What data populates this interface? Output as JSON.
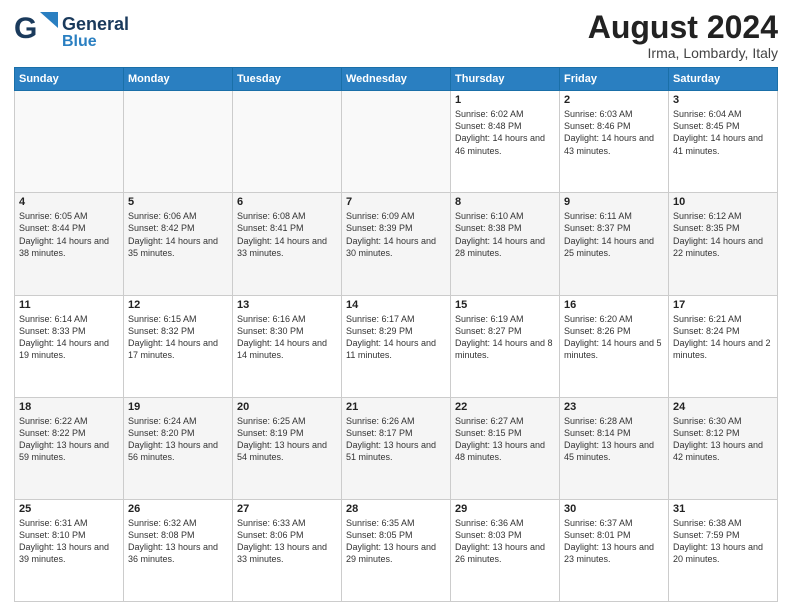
{
  "header": {
    "logo_line1": "General",
    "logo_line2": "Blue",
    "main_title": "August 2024",
    "sub_title": "Irma, Lombardy, Italy"
  },
  "weekdays": [
    "Sunday",
    "Monday",
    "Tuesday",
    "Wednesday",
    "Thursday",
    "Friday",
    "Saturday"
  ],
  "weeks": [
    [
      {
        "num": "",
        "info": ""
      },
      {
        "num": "",
        "info": ""
      },
      {
        "num": "",
        "info": ""
      },
      {
        "num": "",
        "info": ""
      },
      {
        "num": "1",
        "info": "Sunrise: 6:02 AM\nSunset: 8:48 PM\nDaylight: 14 hours and 46 minutes."
      },
      {
        "num": "2",
        "info": "Sunrise: 6:03 AM\nSunset: 8:46 PM\nDaylight: 14 hours and 43 minutes."
      },
      {
        "num": "3",
        "info": "Sunrise: 6:04 AM\nSunset: 8:45 PM\nDaylight: 14 hours and 41 minutes."
      }
    ],
    [
      {
        "num": "4",
        "info": "Sunrise: 6:05 AM\nSunset: 8:44 PM\nDaylight: 14 hours and 38 minutes."
      },
      {
        "num": "5",
        "info": "Sunrise: 6:06 AM\nSunset: 8:42 PM\nDaylight: 14 hours and 35 minutes."
      },
      {
        "num": "6",
        "info": "Sunrise: 6:08 AM\nSunset: 8:41 PM\nDaylight: 14 hours and 33 minutes."
      },
      {
        "num": "7",
        "info": "Sunrise: 6:09 AM\nSunset: 8:39 PM\nDaylight: 14 hours and 30 minutes."
      },
      {
        "num": "8",
        "info": "Sunrise: 6:10 AM\nSunset: 8:38 PM\nDaylight: 14 hours and 28 minutes."
      },
      {
        "num": "9",
        "info": "Sunrise: 6:11 AM\nSunset: 8:37 PM\nDaylight: 14 hours and 25 minutes."
      },
      {
        "num": "10",
        "info": "Sunrise: 6:12 AM\nSunset: 8:35 PM\nDaylight: 14 hours and 22 minutes."
      }
    ],
    [
      {
        "num": "11",
        "info": "Sunrise: 6:14 AM\nSunset: 8:33 PM\nDaylight: 14 hours and 19 minutes."
      },
      {
        "num": "12",
        "info": "Sunrise: 6:15 AM\nSunset: 8:32 PM\nDaylight: 14 hours and 17 minutes."
      },
      {
        "num": "13",
        "info": "Sunrise: 6:16 AM\nSunset: 8:30 PM\nDaylight: 14 hours and 14 minutes."
      },
      {
        "num": "14",
        "info": "Sunrise: 6:17 AM\nSunset: 8:29 PM\nDaylight: 14 hours and 11 minutes."
      },
      {
        "num": "15",
        "info": "Sunrise: 6:19 AM\nSunset: 8:27 PM\nDaylight: 14 hours and 8 minutes."
      },
      {
        "num": "16",
        "info": "Sunrise: 6:20 AM\nSunset: 8:26 PM\nDaylight: 14 hours and 5 minutes."
      },
      {
        "num": "17",
        "info": "Sunrise: 6:21 AM\nSunset: 8:24 PM\nDaylight: 14 hours and 2 minutes."
      }
    ],
    [
      {
        "num": "18",
        "info": "Sunrise: 6:22 AM\nSunset: 8:22 PM\nDaylight: 13 hours and 59 minutes."
      },
      {
        "num": "19",
        "info": "Sunrise: 6:24 AM\nSunset: 8:20 PM\nDaylight: 13 hours and 56 minutes."
      },
      {
        "num": "20",
        "info": "Sunrise: 6:25 AM\nSunset: 8:19 PM\nDaylight: 13 hours and 54 minutes."
      },
      {
        "num": "21",
        "info": "Sunrise: 6:26 AM\nSunset: 8:17 PM\nDaylight: 13 hours and 51 minutes."
      },
      {
        "num": "22",
        "info": "Sunrise: 6:27 AM\nSunset: 8:15 PM\nDaylight: 13 hours and 48 minutes."
      },
      {
        "num": "23",
        "info": "Sunrise: 6:28 AM\nSunset: 8:14 PM\nDaylight: 13 hours and 45 minutes."
      },
      {
        "num": "24",
        "info": "Sunrise: 6:30 AM\nSunset: 8:12 PM\nDaylight: 13 hours and 42 minutes."
      }
    ],
    [
      {
        "num": "25",
        "info": "Sunrise: 6:31 AM\nSunset: 8:10 PM\nDaylight: 13 hours and 39 minutes."
      },
      {
        "num": "26",
        "info": "Sunrise: 6:32 AM\nSunset: 8:08 PM\nDaylight: 13 hours and 36 minutes."
      },
      {
        "num": "27",
        "info": "Sunrise: 6:33 AM\nSunset: 8:06 PM\nDaylight: 13 hours and 33 minutes."
      },
      {
        "num": "28",
        "info": "Sunrise: 6:35 AM\nSunset: 8:05 PM\nDaylight: 13 hours and 29 minutes."
      },
      {
        "num": "29",
        "info": "Sunrise: 6:36 AM\nSunset: 8:03 PM\nDaylight: 13 hours and 26 minutes."
      },
      {
        "num": "30",
        "info": "Sunrise: 6:37 AM\nSunset: 8:01 PM\nDaylight: 13 hours and 23 minutes."
      },
      {
        "num": "31",
        "info": "Sunrise: 6:38 AM\nSunset: 7:59 PM\nDaylight: 13 hours and 20 minutes."
      }
    ]
  ]
}
